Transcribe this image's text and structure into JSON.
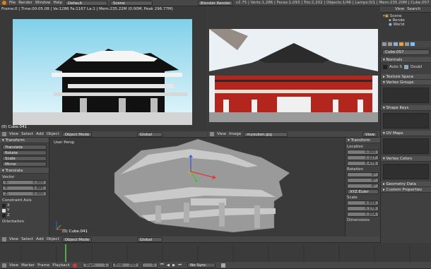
{
  "topbar": {
    "menus": [
      "File",
      "Render",
      "Window",
      "Help"
    ],
    "layout": "Default",
    "scene": "Scene",
    "engine": "Blender Render",
    "stats": "v2.75 | Verts:1,286 | Faces:1,093 | Tris:2,202 | Objects:1/46 | Lamps:0/1 | Mem:235.20M | Cube.057"
  },
  "render_view": {
    "info": "Frame:0 | Time:00:05.08 | Ve:1286 Fa:1167 La:1 | Mem:235.22M (0.00M, Peak 296.77M)",
    "object_label": "(0) Cube.041",
    "menus": [
      "View",
      "Select",
      "Add",
      "Object"
    ],
    "mode": "Object Mode",
    "orientation": "Global"
  },
  "image_editor": {
    "menus": [
      "View",
      "Image"
    ],
    "image_name": "myouken.jpg",
    "view_label": "View"
  },
  "viewport_3d": {
    "view_name": "User Persp",
    "object_label": "(0) Cube.041",
    "menus": [
      "View",
      "Select",
      "Add",
      "Object"
    ],
    "mode": "Object Mode",
    "orientation": "Global"
  },
  "tool_shelf": {
    "transform_title": "Transform",
    "transform_buttons": [
      "Translate",
      "Rotate",
      "Scale",
      "Mirror"
    ],
    "op_title": "Translate",
    "vector_label": "Vector",
    "vector": [
      {
        "axis": "X:",
        "value": "0.000"
      },
      {
        "axis": "Y:",
        "value": "5.885"
      },
      {
        "axis": "Z:",
        "value": "0.000"
      }
    ],
    "constraint_label": "Constraint Axis",
    "constraint_axes": [
      {
        "axis": "X",
        "checked": false
      },
      {
        "axis": "Y",
        "checked": true
      },
      {
        "axis": "Z",
        "checked": false
      }
    ],
    "orientation_label": "Orientation"
  },
  "n_panel": {
    "title": "Transform",
    "location_label": "Location",
    "location": [
      "0.000",
      "2.227",
      "8.478"
    ],
    "rotation_label": "Rotation",
    "rotation": [
      "0°",
      "0°",
      "0°"
    ],
    "rotation_mode": "XYZ Euler",
    "scale_label": "Scale",
    "scale": [
      "6.658",
      "0.178",
      "1.204"
    ],
    "dimensions_label": "Dimensions"
  },
  "outliner": {
    "menus": [
      "View",
      "Search"
    ],
    "items": [
      "Scene",
      "Rende",
      "World"
    ]
  },
  "properties": {
    "object_name": "Cube.057",
    "sections": [
      {
        "title": "Normals",
        "type": "normals"
      },
      {
        "title": "Texture Space",
        "type": "collapsed"
      },
      {
        "title": "Vertex Groups",
        "type": "list"
      },
      {
        "title": "Shape Keys",
        "type": "list"
      },
      {
        "title": "UV Maps",
        "type": "list"
      },
      {
        "title": "Vertex Colors",
        "type": "list"
      },
      {
        "title": "Geometry Data",
        "type": "collapsed"
      },
      {
        "title": "Custom Properties",
        "type": "collapsed"
      }
    ],
    "auto_smooth": "Auto S",
    "double_sided": "Doubl"
  },
  "timeline": {
    "menus": [
      "View",
      "Marker",
      "Frame",
      "Playback"
    ],
    "start_label": "Start:",
    "start": "1",
    "end_label": "End:",
    "end": "250",
    "current": "0",
    "sync": "No Sync"
  },
  "colors": {
    "sky": "#a9dce8",
    "temple_red": "#b3261e",
    "viewport_bg": "#3a3a3a",
    "x_axis": "#e03a3a",
    "y_axis": "#3fc43f",
    "z_axis": "#3a5ee0",
    "selection": "#f09a2a"
  }
}
